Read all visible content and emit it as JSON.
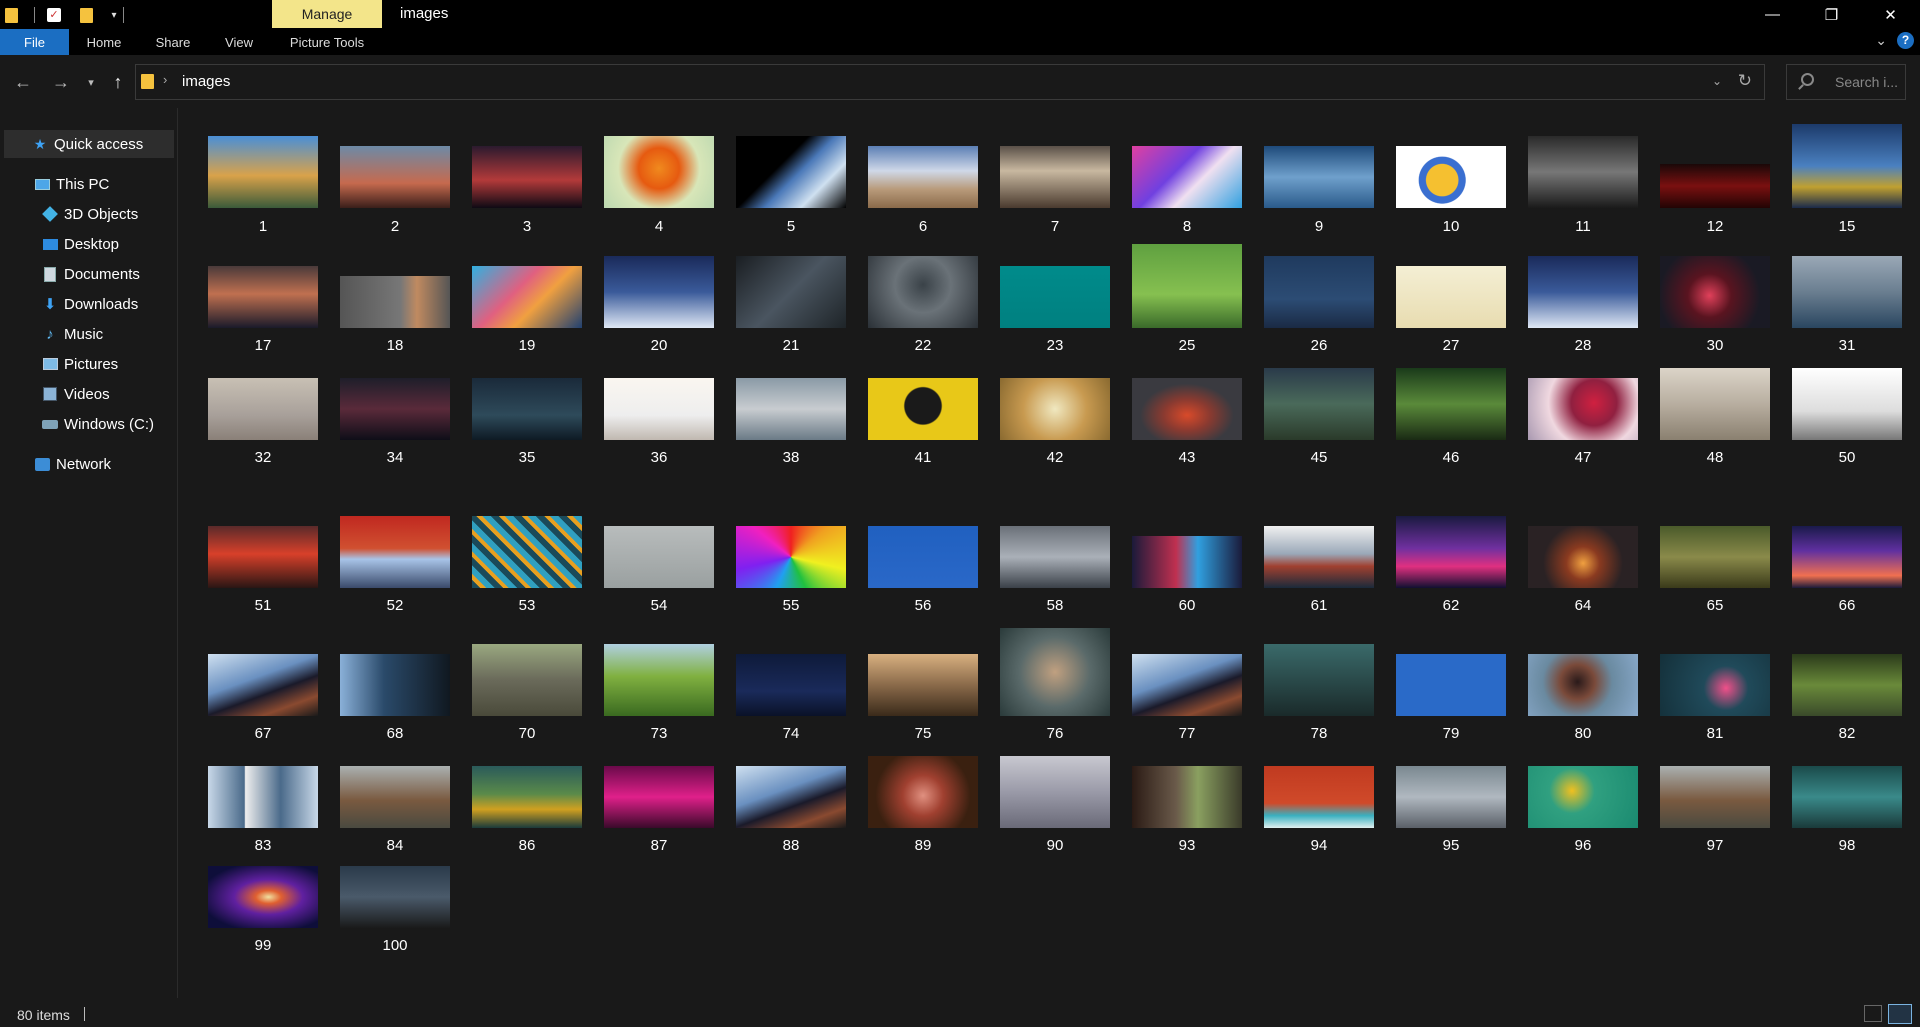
{
  "window": {
    "title": "images",
    "context_tab": "Manage",
    "controls": {
      "minimize": "—",
      "restore": "❐",
      "close": "✕"
    }
  },
  "ribbon": {
    "tabs": [
      "File",
      "Home",
      "Share",
      "View",
      "Picture Tools"
    ],
    "collapse_icon": "chevron-down-icon",
    "help": "?"
  },
  "address": {
    "path": "images",
    "search_placeholder": "Search i..."
  },
  "sidebar": {
    "items": [
      {
        "label": "Quick access",
        "icon": "star-icon"
      },
      {
        "label": "This PC",
        "icon": "computer-icon"
      },
      {
        "label": "3D Objects",
        "icon": "3d-objects-icon"
      },
      {
        "label": "Desktop",
        "icon": "desktop-icon"
      },
      {
        "label": "Documents",
        "icon": "documents-icon"
      },
      {
        "label": "Downloads",
        "icon": "downloads-icon"
      },
      {
        "label": "Music",
        "icon": "music-icon"
      },
      {
        "label": "Pictures",
        "icon": "pictures-icon"
      },
      {
        "label": "Videos",
        "icon": "videos-icon"
      },
      {
        "label": "Windows (C:)",
        "icon": "drive-icon"
      },
      {
        "label": "Network",
        "icon": "network-icon"
      }
    ]
  },
  "files": [
    {
      "name": "1"
    },
    {
      "name": "2"
    },
    {
      "name": "3"
    },
    {
      "name": "4"
    },
    {
      "name": "5"
    },
    {
      "name": "6"
    },
    {
      "name": "7"
    },
    {
      "name": "8"
    },
    {
      "name": "9"
    },
    {
      "name": "10"
    },
    {
      "name": "11"
    },
    {
      "name": "12"
    },
    {
      "name": "15"
    },
    {
      "name": "17"
    },
    {
      "name": "18"
    },
    {
      "name": "19"
    },
    {
      "name": "20"
    },
    {
      "name": "21"
    },
    {
      "name": "22"
    },
    {
      "name": "23"
    },
    {
      "name": "25"
    },
    {
      "name": "26"
    },
    {
      "name": "27"
    },
    {
      "name": "28"
    },
    {
      "name": "30"
    },
    {
      "name": "31"
    },
    {
      "name": "32"
    },
    {
      "name": "34"
    },
    {
      "name": "35"
    },
    {
      "name": "36"
    },
    {
      "name": "38"
    },
    {
      "name": "41"
    },
    {
      "name": "42"
    },
    {
      "name": "43"
    },
    {
      "name": "45"
    },
    {
      "name": "46"
    },
    {
      "name": "47"
    },
    {
      "name": "48"
    },
    {
      "name": "50"
    },
    {
      "name": "51"
    },
    {
      "name": "52"
    },
    {
      "name": "53"
    },
    {
      "name": "54"
    },
    {
      "name": "55"
    },
    {
      "name": "56"
    },
    {
      "name": "58"
    },
    {
      "name": "60"
    },
    {
      "name": "61"
    },
    {
      "name": "62"
    },
    {
      "name": "64"
    },
    {
      "name": "65"
    },
    {
      "name": "66"
    },
    {
      "name": "67"
    },
    {
      "name": "68"
    },
    {
      "name": "70"
    },
    {
      "name": "73"
    },
    {
      "name": "74"
    },
    {
      "name": "75"
    },
    {
      "name": "76"
    },
    {
      "name": "77"
    },
    {
      "name": "78"
    },
    {
      "name": "79"
    },
    {
      "name": "80"
    },
    {
      "name": "81"
    },
    {
      "name": "82"
    },
    {
      "name": "83"
    },
    {
      "name": "84"
    },
    {
      "name": "86"
    },
    {
      "name": "87"
    },
    {
      "name": "88"
    },
    {
      "name": "89"
    },
    {
      "name": "90"
    },
    {
      "name": "93"
    },
    {
      "name": "94"
    },
    {
      "name": "95"
    },
    {
      "name": "96"
    },
    {
      "name": "97"
    },
    {
      "name": "98"
    },
    {
      "name": "99"
    },
    {
      "name": "100"
    }
  ],
  "status": {
    "item_count": "80 items"
  }
}
